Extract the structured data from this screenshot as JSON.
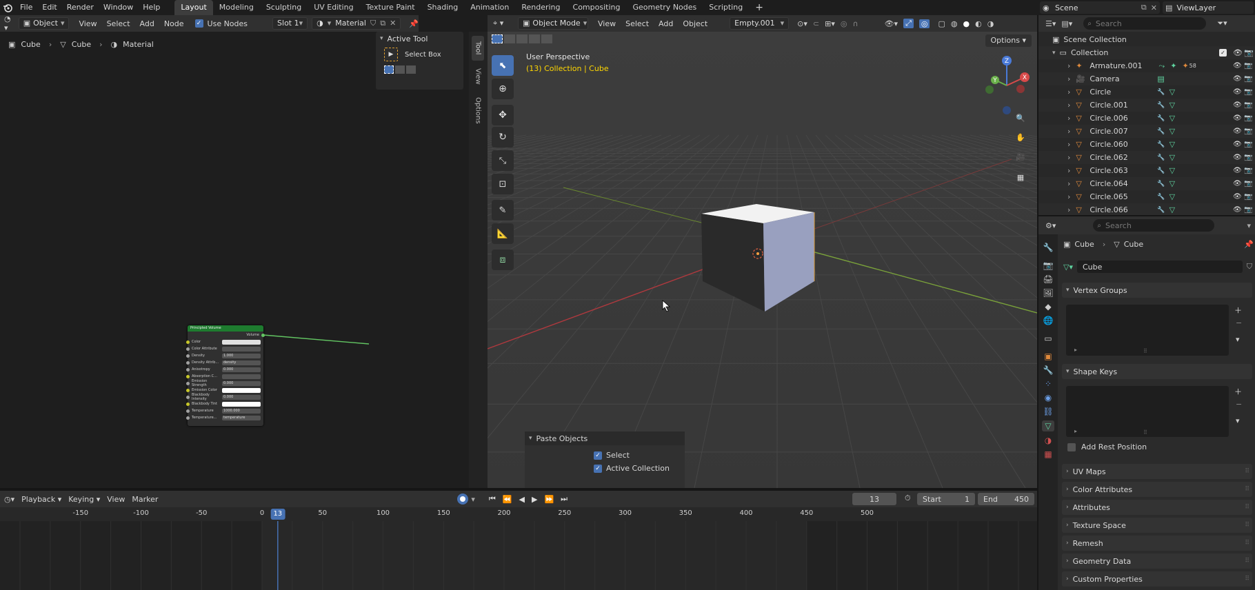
{
  "topbar": {
    "menu": [
      "File",
      "Edit",
      "Render",
      "Window",
      "Help"
    ],
    "workspaces": [
      "Layout",
      "Modeling",
      "Sculpting",
      "UV Editing",
      "Texture Paint",
      "Shading",
      "Animation",
      "Rendering",
      "Compositing",
      "Geometry Nodes",
      "Scripting"
    ],
    "active_workspace": "Layout",
    "scene": "Scene",
    "view_layer": "ViewLayer"
  },
  "node_editor": {
    "object_type": "Object",
    "menus": [
      "View",
      "Select",
      "Add",
      "Node"
    ],
    "use_nodes": "Use Nodes",
    "slot": "Slot 1",
    "material": "Material",
    "breadcrumb": [
      "Cube",
      "Cube",
      "Material"
    ],
    "npanel": {
      "title": "Active Tool",
      "tool": "Select Box"
    },
    "vtabs": [
      "Tool",
      "View",
      "Options"
    ],
    "node": {
      "title": "Principled Volume",
      "output": "Volume",
      "rows": [
        {
          "label": "Color",
          "value": ""
        },
        {
          "label": "Color Attribute",
          "value": ""
        },
        {
          "label": "Density",
          "value": "1.000"
        },
        {
          "label": "Density Attrib...",
          "value": "density"
        },
        {
          "label": "Anisotropy",
          "value": "0.000"
        },
        {
          "label": "Absorption C...",
          "value": ""
        },
        {
          "label": "Emission Strength",
          "value": "0.000"
        },
        {
          "label": "Emission Color",
          "value": ""
        },
        {
          "label": "Blackbody Intensity",
          "value": "0.000"
        },
        {
          "label": "Blackbody Tint",
          "value": ""
        },
        {
          "label": "Temperature",
          "value": "1000.000"
        },
        {
          "label": "Temperature...",
          "value": "temperature"
        }
      ]
    }
  },
  "viewport": {
    "mode": "Object Mode",
    "menus": [
      "View",
      "Select",
      "Add",
      "Object"
    ],
    "active_object": "Empty.001",
    "options": "Options",
    "perspective": "User Perspective",
    "collection_info": "(13) Collection | Cube",
    "gizmo": {
      "x": "X",
      "y": "Y",
      "z": "Z"
    },
    "paste_panel": {
      "title": "Paste Objects",
      "select": "Select",
      "active_collection": "Active Collection"
    }
  },
  "outliner": {
    "search_placeholder": "Search",
    "scene_collection": "Scene Collection",
    "collection": "Collection",
    "items": [
      {
        "name": "Armature.001",
        "type": "armature",
        "extra": "58"
      },
      {
        "name": "Camera",
        "type": "camera"
      },
      {
        "name": "Circle",
        "type": "mesh"
      },
      {
        "name": "Circle.001",
        "type": "mesh"
      },
      {
        "name": "Circle.006",
        "type": "mesh"
      },
      {
        "name": "Circle.007",
        "type": "mesh"
      },
      {
        "name": "Circle.060",
        "type": "mesh"
      },
      {
        "name": "Circle.062",
        "type": "mesh"
      },
      {
        "name": "Circle.063",
        "type": "mesh"
      },
      {
        "name": "Circle.064",
        "type": "mesh"
      },
      {
        "name": "Circle.065",
        "type": "mesh"
      },
      {
        "name": "Circle.066",
        "type": "mesh"
      }
    ]
  },
  "properties": {
    "search_placeholder": "Search",
    "breadcrumb": [
      "Cube",
      "Cube"
    ],
    "data_name": "Cube",
    "vertex_groups": "Vertex Groups",
    "shape_keys": "Shape Keys",
    "add_rest_position": "Add Rest Position",
    "panels": [
      "UV Maps",
      "Color Attributes",
      "Attributes",
      "Texture Space",
      "Remesh",
      "Geometry Data",
      "Custom Properties"
    ]
  },
  "timeline": {
    "menus": [
      "Playback",
      "Keying",
      "View",
      "Marker"
    ],
    "current_frame": "13",
    "start_label": "Start",
    "start": "1",
    "end_label": "End",
    "end": "450",
    "ruler": [
      "-150",
      "-100",
      "-50",
      "0",
      "50",
      "100",
      "150",
      "200",
      "250",
      "300",
      "350",
      "400",
      "450",
      "500"
    ],
    "playhead": "13"
  },
  "colors": {
    "accent": "#4772b3",
    "active_tab": "#3d3d3d",
    "node_header": "#1e7c2f",
    "info_yellow": "#ffd700",
    "mesh_icon": "#e08a3c",
    "data_icon": "#5fd4a0"
  }
}
